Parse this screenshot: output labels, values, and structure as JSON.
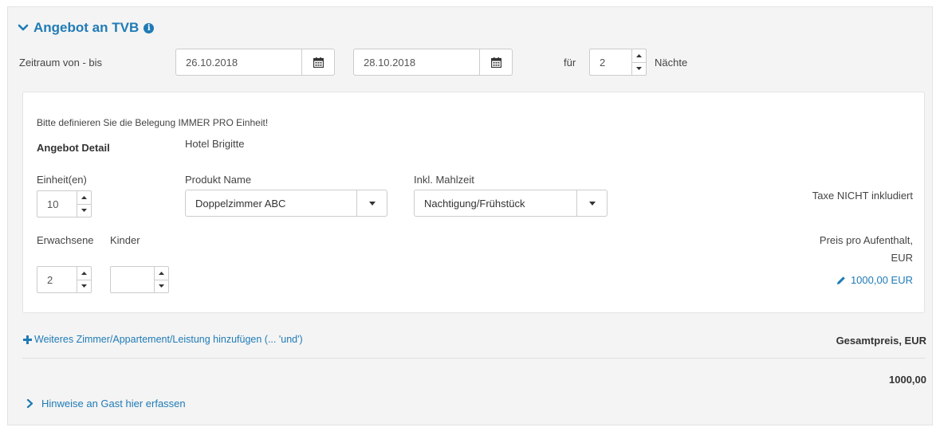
{
  "section": {
    "title": "Angebot an TVB",
    "info_icon": "info-circle-icon"
  },
  "period": {
    "label": "Zeitraum von - bis",
    "from": "26.10.2018",
    "to": "28.10.2018",
    "for_label": "für",
    "nights": "2",
    "nights_label": "Nächte"
  },
  "offer": {
    "notice": "Bitte definieren Sie die Belegung IMMER PRO Einheit!",
    "detail_label": "Angebot Detail",
    "hotel": "Hotel Brigitte",
    "units_label": "Einheit(en)",
    "units": "10",
    "product_label": "Produkt Name",
    "product": "Doppelzimmer ABC",
    "meal_label": "Inkl. Mahlzeit",
    "meal": "Nachtigung/Frühstück",
    "tax_note": "Taxe NICHT inkludiert",
    "adults_label": "Erwachsene",
    "children_label": "Kinder",
    "adults": "2",
    "children": "",
    "price_label_1": "Preis pro Aufenthalt,",
    "price_label_2": "EUR",
    "price": "1000,00 EUR"
  },
  "footer": {
    "add_link": "Weiteres Zimmer/Appartement/Leistung hinzufügen (... 'und')",
    "total_label": "Gesamtpreis, EUR",
    "total": "1000,00",
    "notes_link": "Hinweise an Gast hier erfassen"
  },
  "colors": {
    "accent": "#1f7bb6",
    "panel_bg": "#f4f4f4"
  }
}
